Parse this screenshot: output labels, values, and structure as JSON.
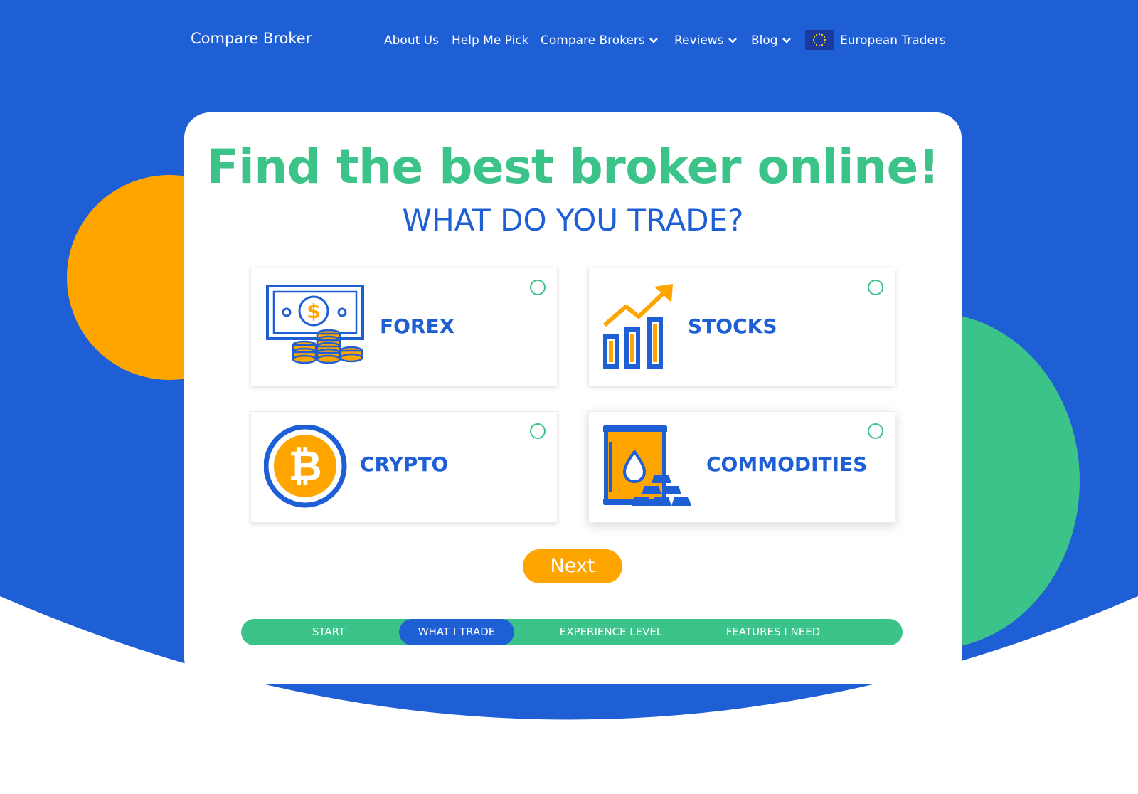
{
  "colors": {
    "blue": "#1f5fd6",
    "green": "#3cc389",
    "orange": "#ffa500",
    "white": "#ffffff"
  },
  "nav": {
    "logo": "Compare Broker",
    "about": "About Us",
    "help": "Help Me Pick",
    "compare": "Compare Brokers",
    "reviews": "Reviews",
    "blog": "Blog",
    "region": "European Traders"
  },
  "card": {
    "title": "Find the best broker online!",
    "subtitle": "WHAT DO YOU TRADE?"
  },
  "options": [
    {
      "label": "FOREX",
      "icon": "cash-coins-icon",
      "selected": false
    },
    {
      "label": "STOCKS",
      "icon": "bar-chart-up-icon",
      "selected": false
    },
    {
      "label": "CRYPTO",
      "icon": "bitcoin-icon",
      "selected": false
    },
    {
      "label": "COMMODITIES",
      "icon": "oil-barrel-gold-icon",
      "selected": false
    }
  ],
  "next_label": "Next",
  "steps": [
    {
      "label": "START",
      "active": false
    },
    {
      "label": "WHAT I TRADE",
      "active": true
    },
    {
      "label": "EXPERIENCE LEVEL",
      "active": false
    },
    {
      "label": "FEATURES I NEED",
      "active": false
    }
  ]
}
